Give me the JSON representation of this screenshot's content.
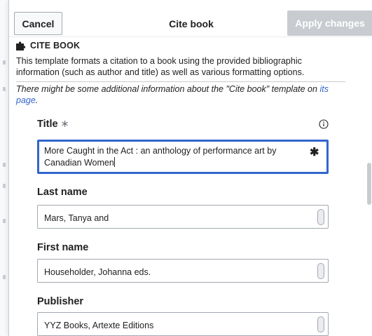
{
  "dialog": {
    "title": "Cite book",
    "cancel_label": "Cancel",
    "apply_label": "Apply changes"
  },
  "template": {
    "name": "Cite book",
    "description": "This template formats a citation to a book using the provided bibliographic information (such as author and title) as well as various formatting options.",
    "note_text": "There might be some additional information about the \"Cite book\" template on ",
    "note_link": "its page",
    "note_end": "."
  },
  "fields": {
    "title": {
      "label": "Title",
      "required_marker": "∗",
      "value": "More Caught in the Act : an anthology of performance art by Canadian Women",
      "asterisk": "✱"
    },
    "last_name": {
      "label": "Last name",
      "value": "Mars, Tanya and"
    },
    "first_name": {
      "label": "First name",
      "value": "Householder, Johanna eds."
    },
    "publisher": {
      "label": "Publisher",
      "value": "YYZ Books, Artexte Editions"
    }
  },
  "icons": {
    "template": "puzzle-icon",
    "info": "info-icon",
    "resize": "grip-icon"
  },
  "colors": {
    "accent": "#3366cc",
    "apply_disabled": "#c8ccd1",
    "border": "#a2a9b1"
  }
}
